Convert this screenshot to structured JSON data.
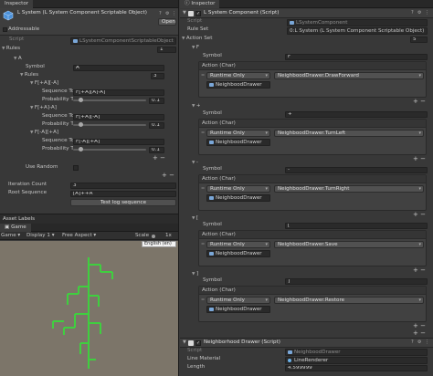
{
  "left": {
    "inspector_tab": "Inspector",
    "object_title": "L System (L System Component Scriptable Object)",
    "open_button": "Open",
    "addressable": "Addressable",
    "script_label": "Script",
    "script_value": "LSystemComponentScriptableObject",
    "rules_label": "Rules",
    "rules_count": "1",
    "rule_a_label": "A",
    "symbol_label": "Symbol",
    "symbol_value": "A",
    "inner_rules_label": "Rules",
    "inner_rules_count": "3",
    "seq_items": [
      {
        "header": "F[+A][-A]",
        "seq_label": "Sequence To",
        "seq_value": "F[+A][A]-A]",
        "prob_label": "Probability To",
        "prob_value": "0.1"
      },
      {
        "header": "F[+A]-A]",
        "seq_label": "Sequence To",
        "seq_value": "F[+A][-A]",
        "prob_label": "Probability To",
        "prob_value": "0.1"
      },
      {
        "header": "F[-A][+A]",
        "seq_label": "Sequence To",
        "seq_value": "F[-A][+A]",
        "prob_label": "Probability To",
        "prob_value": "0.1"
      }
    ],
    "use_random": "Use Random",
    "iteration_count_label": "Iteration Count",
    "iteration_count_value": "3",
    "root_sequence_label": "Root Sequence",
    "root_sequence_value": "[A]++A",
    "test_button": "Test log sequence",
    "asset_labels": "Asset Labels"
  },
  "game": {
    "tab": "Game",
    "display_select": "Game",
    "display": "Display 1",
    "aspect": "Free Aspect",
    "scale_label": "Scale",
    "scale_value": "1x",
    "locale": "English (en)"
  },
  "right": {
    "inspector_tab": "Inspector",
    "component_title": "L System Component (Script)",
    "script_label": "Script",
    "script_value": "LSystemComponent",
    "rule_set_label": "Rule Set",
    "rule_set_value": "0:L System (L System Component Scriptable Object)",
    "action_set_label": "Action Set",
    "action_set_count": "5",
    "actions": [
      {
        "header": "F",
        "symbol_value": "F",
        "mode": "Runtime Only",
        "target": "NeighboodDrawer",
        "method": "NeighboodDrawer.DrawForward"
      },
      {
        "header": "+",
        "symbol_value": "+",
        "mode": "Runtime Only",
        "target": "NeighboodDrawer",
        "method": "NeighboodDrawer.TurnLeft"
      },
      {
        "header": "-",
        "symbol_value": "-",
        "mode": "Runtime Only",
        "target": "NeighboodDrawer",
        "method": "NeighboodDrawer.TurnRight"
      },
      {
        "header": "[",
        "symbol_value": "[",
        "mode": "Runtime Only",
        "target": "NeighboodDrawer",
        "method": "NeighboodDrawer.Save"
      },
      {
        "header": "]",
        "symbol_value": "]",
        "mode": "Runtime Only",
        "target": "NeighboodDrawer",
        "method": "NeighboodDrawer.Restore"
      }
    ],
    "symbol_label": "Symbol",
    "action_label": "Action (Char)",
    "drawer_title": "Neighborhood Drawer (Script)",
    "drawer_script_value": "NeighboodDrawer",
    "line_material_label": "Line Material",
    "line_material_value": "LineRenderer",
    "length_label": "Length",
    "length_value": "4.599999"
  }
}
